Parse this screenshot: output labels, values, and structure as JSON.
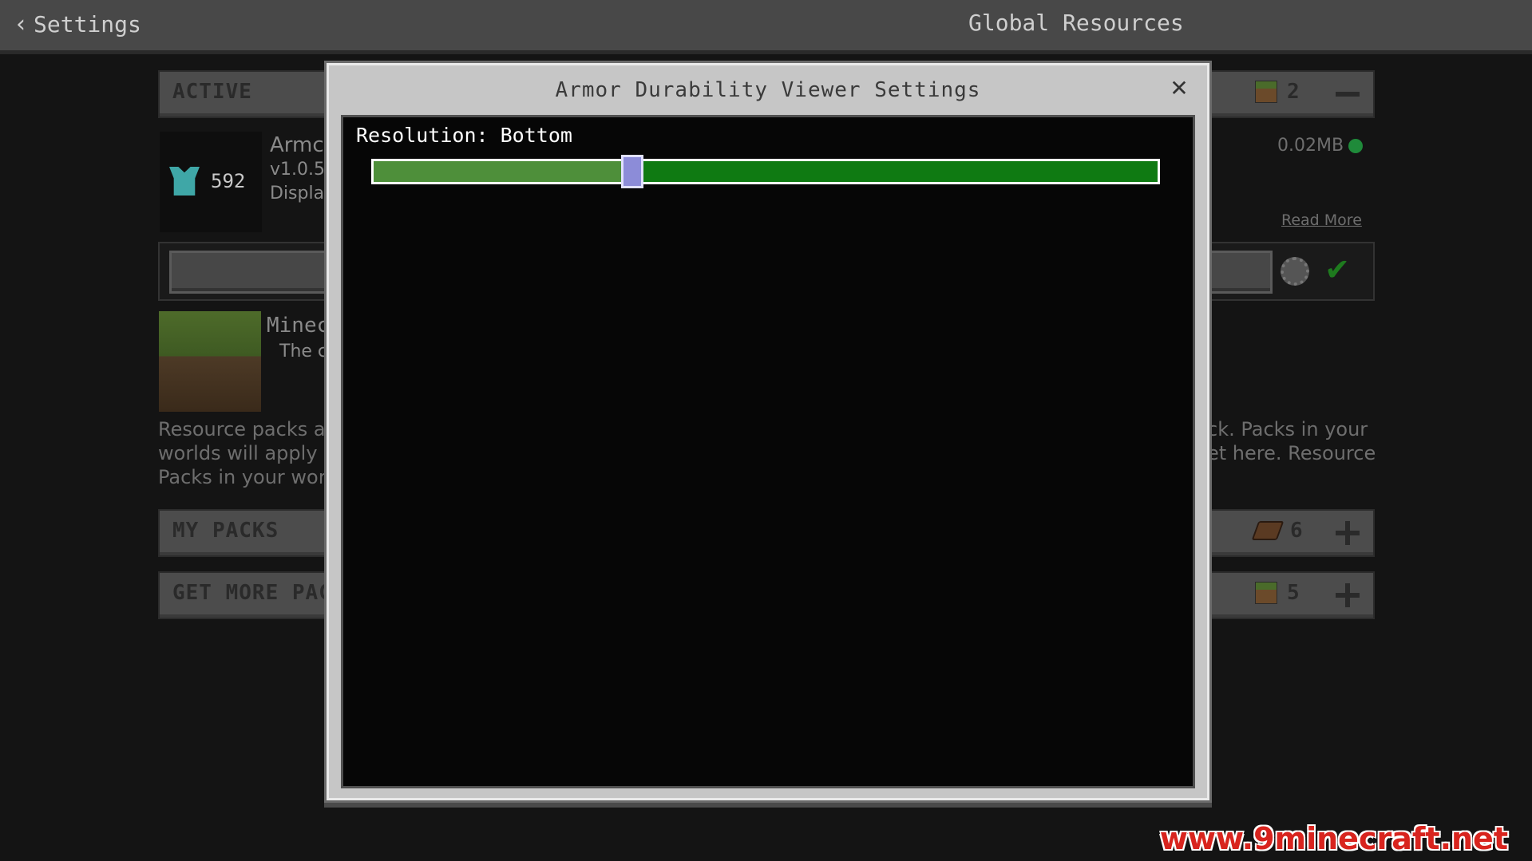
{
  "topbar": {
    "back_label": "Settings",
    "title": "Global Resources"
  },
  "background": {
    "active_section": {
      "label": "ACTIVE",
      "count": "2"
    },
    "active_pack": {
      "name": "Armc",
      "version": "v1.0.5",
      "desc": "Displa",
      "icon_value": "592",
      "size": "0.02MB",
      "read_more": "Read More"
    },
    "minecraft_pack": {
      "name": "Minec",
      "desc": "The c"
    },
    "info_text_left": [
      "Resource packs are",
      "worlds will apply o",
      "Packs in your world"
    ],
    "info_text_right": [
      "ck. Packs in your",
      "et here. Resource"
    ],
    "my_packs": {
      "label": "MY PACKS",
      "count": "6"
    },
    "get_more": {
      "label": "GET MORE PAC",
      "count": "5"
    }
  },
  "modal": {
    "title": "Armor Durability Viewer Settings",
    "setting_label": "Resolution: Bottom",
    "slider_value": 0.33
  },
  "watermark": "www.9minecraft.net",
  "colors": {
    "slider_track": "#0f7a12",
    "slider_fill": "#4e8f3a",
    "slider_thumb": "#8c8cd8",
    "watermark": "#d8241e"
  }
}
